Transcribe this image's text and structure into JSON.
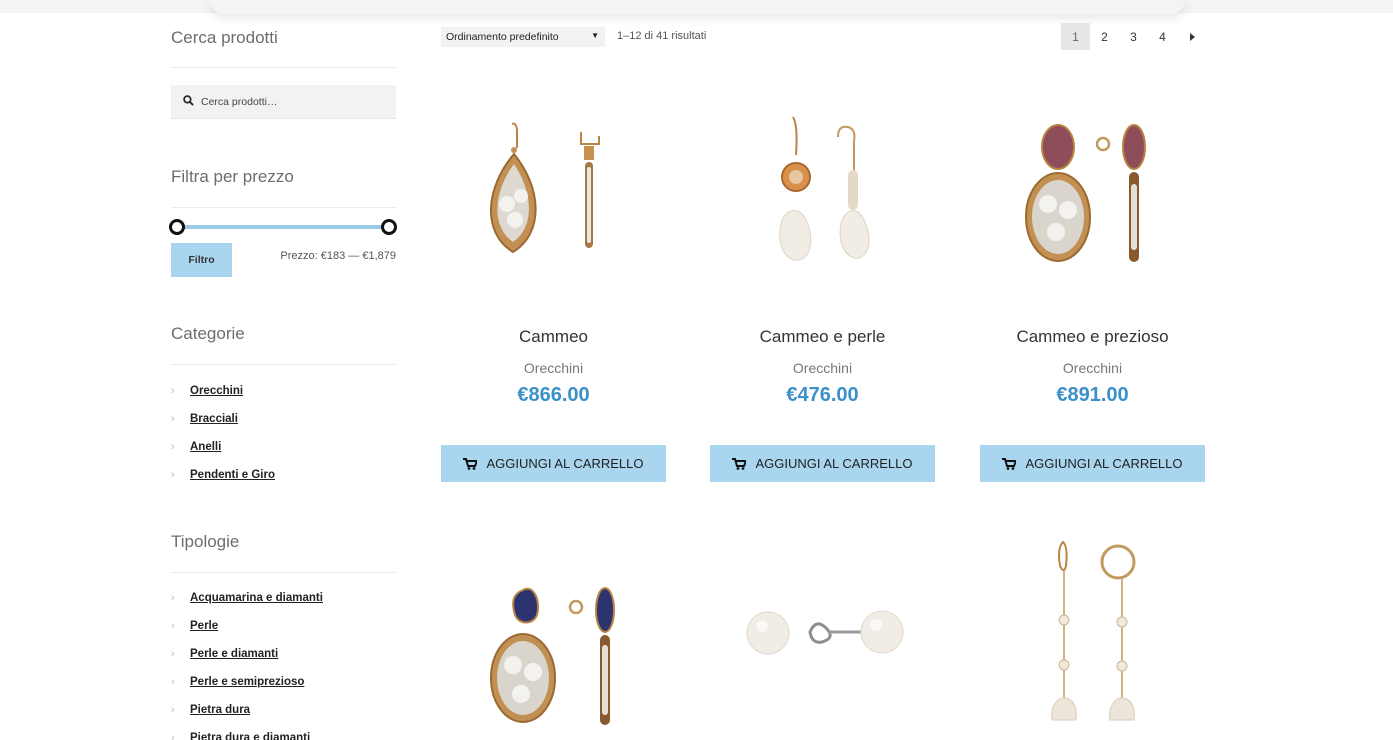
{
  "sidebar": {
    "search_title": "Cerca prodotti",
    "search_placeholder": "Cerca prodotti…",
    "price_title": "Filtra per prezzo",
    "filter_button": "Filtro",
    "price_range": "Prezzo: €183 — €1,879",
    "categories_title": "Categorie",
    "categories": [
      "Orecchini",
      "Bracciali",
      "Anelli",
      "Pendenti e Giro"
    ],
    "types_title": "Tipologie",
    "types": [
      "Acquamarina e diamanti",
      "Perle",
      "Perle e diamanti",
      "Perle e semiprezioso",
      "Pietra dura",
      "Pietra dura e diamanti"
    ]
  },
  "toolbar": {
    "orderby": "Ordinamento predefinito",
    "result_count": "1–12 di 41 risultati",
    "pages": [
      "1",
      "2",
      "3",
      "4"
    ],
    "current_page": "1",
    "next_icon": "triangle-right-icon"
  },
  "products": [
    {
      "title": "Cammeo",
      "category": "Orecchini",
      "price": "€866.00",
      "button": "AGGIUNGI AL CARRELLO"
    },
    {
      "title": "Cammeo e perle",
      "category": "Orecchini",
      "price": "€476.00",
      "button": "AGGIUNGI AL CARRELLO"
    },
    {
      "title": "Cammeo e prezioso",
      "category": "Orecchini",
      "price": "€891.00",
      "button": "AGGIUNGI AL CARRELLO"
    }
  ],
  "colors": {
    "accent_button": "#a9d5ef",
    "price": "#3b90c8",
    "slider": "#9cc9e6"
  }
}
